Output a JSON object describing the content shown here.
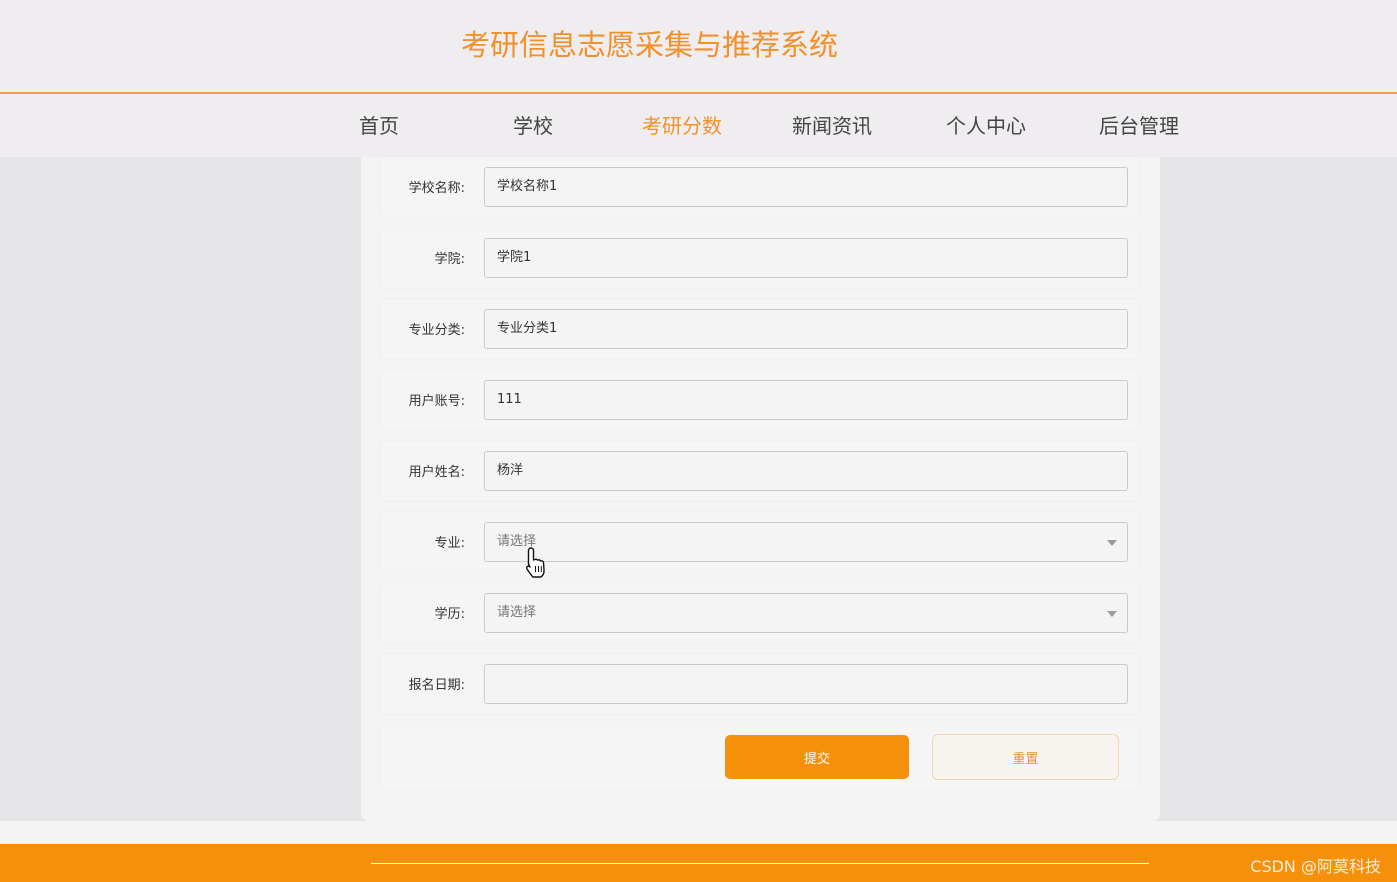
{
  "header": {
    "title": "考研信息志愿采集与推荐系统"
  },
  "nav": {
    "items": [
      {
        "label": "首页"
      },
      {
        "label": "学校"
      },
      {
        "label": "考研分数"
      },
      {
        "label": "新闻资讯"
      },
      {
        "label": "个人中心"
      },
      {
        "label": "后台管理"
      }
    ],
    "active": "考研分数"
  },
  "form": {
    "school_name": {
      "label": "学校名称:",
      "value": "学校名称1"
    },
    "college": {
      "label": "学院:",
      "value": "学院1"
    },
    "major_category": {
      "label": "专业分类:",
      "value": "专业分类1"
    },
    "user_account": {
      "label": "用户账号:",
      "value": "111"
    },
    "user_name": {
      "label": "用户姓名:",
      "value": "杨洋"
    },
    "major": {
      "label": "专业:",
      "placeholder": "请选择"
    },
    "education": {
      "label": "学历:",
      "placeholder": "请选择"
    },
    "signup_date": {
      "label": "报名日期:",
      "value": ""
    },
    "submit_label": "提交",
    "reset_label": "重置"
  },
  "footer": {
    "watermark": "CSDN @阿莫科技"
  },
  "colors": {
    "accent": "#f5900a",
    "title": "#f0912a"
  }
}
